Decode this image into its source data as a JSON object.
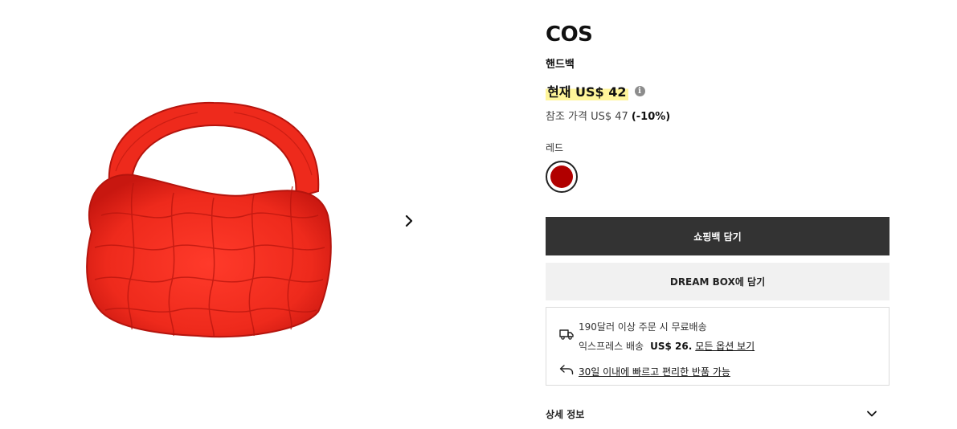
{
  "product": {
    "brand": "COS",
    "category": "핸드백",
    "price_current": "현재 US$ 42",
    "price_info_icon": "info-icon",
    "price_reference": "참조 가격 US$ 47",
    "discount": "(-10%)",
    "color_label": "레드",
    "swatch_color": "#b10000",
    "image": {
      "name": "red-quilted-bag",
      "color": "#e8261e"
    }
  },
  "actions": {
    "add_to_cart": "쇼핑백 담기",
    "add_to_dream_box": "DREAM BOX에 담기"
  },
  "shipping": {
    "free_shipping": "190달러 이상 주문 시 무료배송",
    "express_label": "익스프레스 배송",
    "express_price": "US$ 26.",
    "options_link": "모든 옵션 보기",
    "returns_link": "30일 이내에 빠르고 편리한 반품 가능",
    "truck_icon": "truck-icon",
    "return_icon": "return-arrow-icon"
  },
  "details": {
    "label": "상세 정보",
    "icon": "chevron-down-icon"
  },
  "gallery": {
    "next_icon": "chevron-right-icon"
  }
}
